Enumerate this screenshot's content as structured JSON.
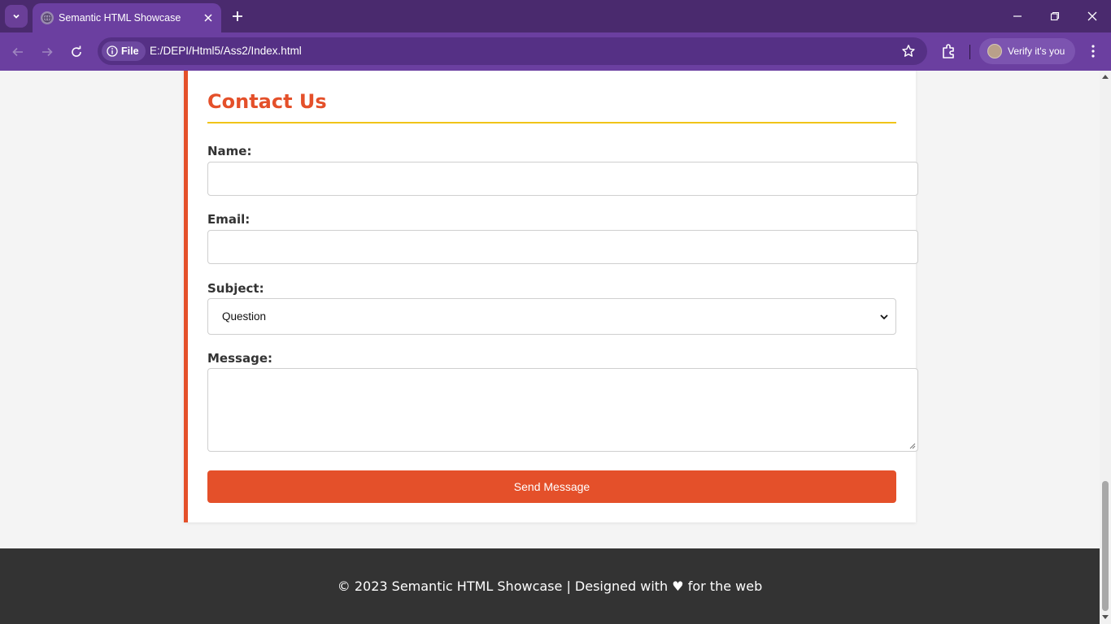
{
  "browser": {
    "tab_title": "Semantic HTML Showcase",
    "scheme_label": "File",
    "url": "E:/DEPI/Html5/Ass2/Index.html",
    "profile_label": "Verify it's you",
    "colors": {
      "frame": "#4a2a6e",
      "toolbar": "#6b3fa0",
      "omnibox": "#553085"
    }
  },
  "contact": {
    "title": "Contact Us",
    "name_label": "Name:",
    "email_label": "Email:",
    "subject_label": "Subject:",
    "subject_value": "Question",
    "message_label": "Message:",
    "send_label": "Send Message",
    "colors": {
      "accent": "#e4502a",
      "rule": "#f0c419"
    }
  },
  "footer": {
    "text": "© 2023 Semantic HTML Showcase | Designed with ♥ for the web"
  }
}
